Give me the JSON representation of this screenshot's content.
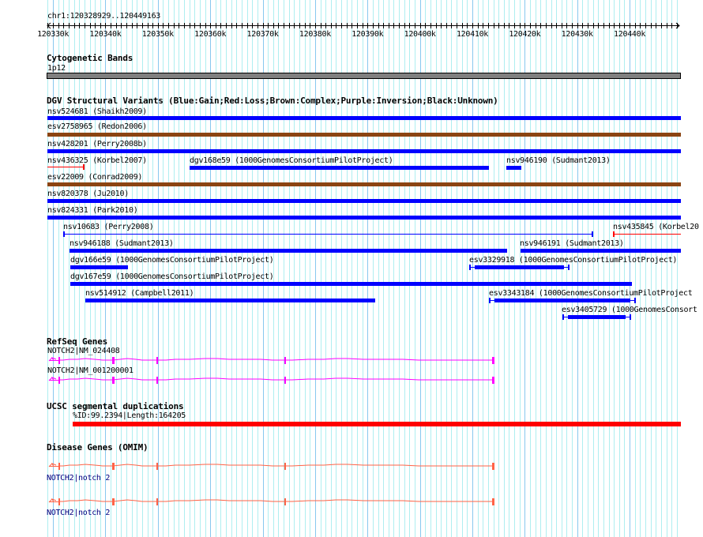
{
  "location": "chr1:120328929..120449163",
  "ruler": {
    "ticks": [
      "120330k",
      "120340k",
      "120350k",
      "120360k",
      "120370k",
      "120380k",
      "120390k",
      "120400k",
      "120410k",
      "120420k",
      "120430k",
      "120440k"
    ]
  },
  "colors": {
    "gain": "#0000ff",
    "loss": "#ff0000",
    "complex": "#8b4513",
    "refseq": "#ff00ff",
    "omim": "#ff6347",
    "band": "#808080",
    "segdup": "#ff0000",
    "grid_minor": "#aeeef0",
    "grid_major": "#88c8ee"
  },
  "tracks": {
    "cyto": {
      "title": "Cytogenetic Bands",
      "band": "1p12"
    },
    "dgv": {
      "title": "DGV Structural Variants (Blue:Gain;Red:Loss;Brown:Complex;Purple:Inversion;Black:Unknown)",
      "features": [
        {
          "label": "nsv524681 (Shaikh2009)",
          "type": "gain"
        },
        {
          "label": "esv2758965 (Redon2006)",
          "type": "complex"
        },
        {
          "label": "nsv428201 (Perry2008b)",
          "type": "gain"
        },
        {
          "label": "nsv436325 (Korbel2007)",
          "type": "loss"
        },
        {
          "label": "dgv168e59 (1000GenomesConsortiumPilotProject)",
          "type": "gain"
        },
        {
          "label": "nsv946190 (Sudmant2013)",
          "type": "gain"
        },
        {
          "label": "esv22009 (Conrad2009)",
          "type": "complex"
        },
        {
          "label": "nsv820378 (Ju2010)",
          "type": "gain"
        },
        {
          "label": "nsv824331 (Park2010)",
          "type": "gain"
        },
        {
          "label": "nsv10683 (Perry2008)",
          "type": "gain"
        },
        {
          "label": "nsv435845 (Korbel20",
          "type": "loss"
        },
        {
          "label": "nsv946188 (Sudmant2013)",
          "type": "gain"
        },
        {
          "label": "nsv946191 (Sudmant2013)",
          "type": "gain"
        },
        {
          "label": "dgv166e59 (1000GenomesConsortiumPilotProject)",
          "type": "gain"
        },
        {
          "label": "esv3329918 (1000GenomesConsortiumPilotProject)",
          "type": "gain"
        },
        {
          "label": "dgv167e59 (1000GenomesConsortiumPilotProject)",
          "type": "gain"
        },
        {
          "label": "nsv514912 (Campbell2011)",
          "type": "gain"
        },
        {
          "label": "esv3343184 (1000GenomesConsortiumPilotProject",
          "type": "gain"
        },
        {
          "label": "esv3405729 (1000GenomesConsort",
          "type": "gain"
        }
      ]
    },
    "refseq": {
      "title": "RefSeq Genes",
      "genes": [
        {
          "label": "NOTCH2|NM_024408"
        },
        {
          "label": "NOTCH2|NM_001200001"
        }
      ]
    },
    "segdup": {
      "title": "UCSC segmental duplications",
      "label": "%ID:99.2394|Length:164205"
    },
    "omim": {
      "title": "Disease Genes (OMIM)",
      "genes": [
        {
          "label": "NOTCH2|notch 2"
        },
        {
          "label": "NOTCH2|notch 2"
        }
      ]
    }
  }
}
